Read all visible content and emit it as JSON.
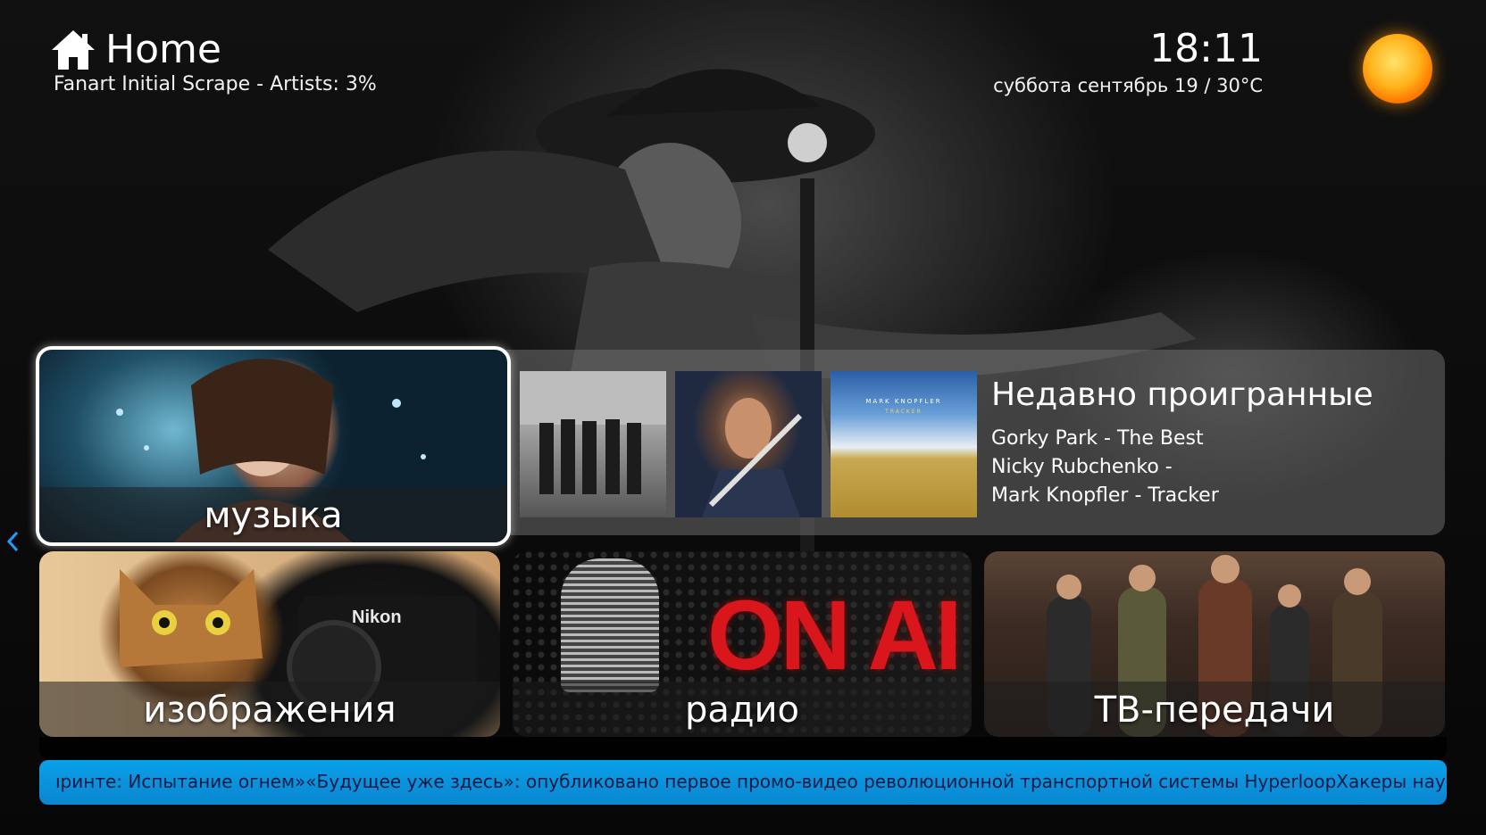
{
  "header": {
    "title": "Home",
    "icon": "home-icon",
    "status": "Fanart Initial Scrape - Artists: 3%"
  },
  "clock": {
    "time": "18:11",
    "date_weather": "суббота сентябрь 19 / 30°C",
    "weather_icon": "sun-icon"
  },
  "tiles": {
    "music": "музыка",
    "images": "изображения",
    "radio": "радио",
    "tv": "ТВ-передачи",
    "radio_art_text": "ON AI"
  },
  "recent": {
    "heading": "Недавно проигранные",
    "items": [
      "Gorky Park - The Best",
      "Nicky Rubchenko -",
      "Mark Knopfler - Tracker"
    ],
    "album3_artist": "MARK KNOPFLER",
    "album3_title": "TRACKER"
  },
  "ticker": {
    "text": "ıринте: Испытание огнем»«Будущее уже здесь»: опубликовано первое промо-видео революционной транспортной системы HyperloopХакеры науч"
  },
  "colors": {
    "ticker_bg": "#0a96e0",
    "focus_border": "#ffffff",
    "onair_red": "#d8161c"
  }
}
